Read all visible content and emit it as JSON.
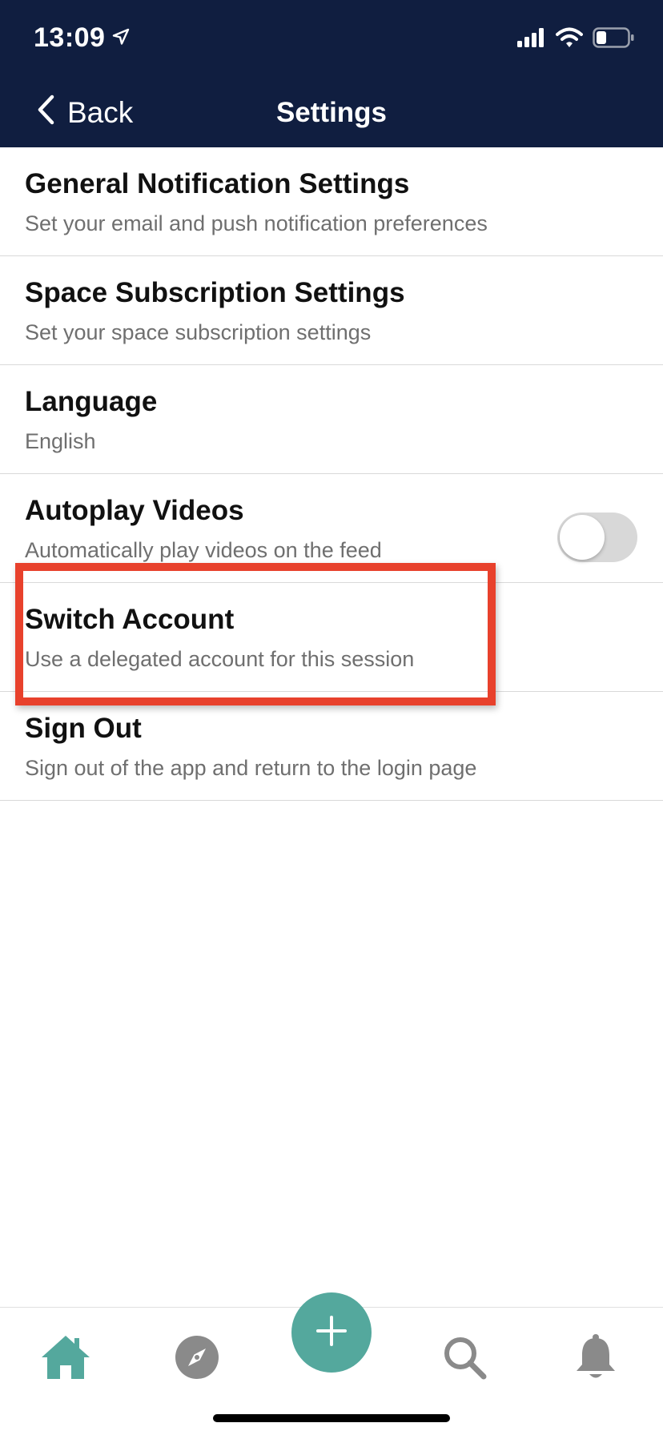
{
  "status_bar": {
    "time": "13:09"
  },
  "header": {
    "back_label": "Back",
    "title": "Settings"
  },
  "settings": [
    {
      "title": "General Notification Settings",
      "subtitle": "Set your email and push notification preferences"
    },
    {
      "title": "Space Subscription Settings",
      "subtitle": "Set your space subscription settings"
    },
    {
      "title": "Language",
      "subtitle": "English"
    },
    {
      "title": "Autoplay Videos",
      "subtitle": "Automatically play videos on the feed",
      "toggle_on": false
    },
    {
      "title": "Switch Account",
      "subtitle": "Use a delegated account for this session"
    },
    {
      "title": "Sign Out",
      "subtitle": "Sign out of the app and return to the login page"
    }
  ],
  "bottom_nav": {
    "icons": [
      "home-icon",
      "compass-icon",
      "plus-icon",
      "search-icon",
      "bell-icon"
    ],
    "active": "home-icon"
  },
  "colors": {
    "header_bg": "#101e40",
    "accent": "#54a89d",
    "highlight": "#e8412c",
    "inactive_icon": "#8a8a8a"
  }
}
